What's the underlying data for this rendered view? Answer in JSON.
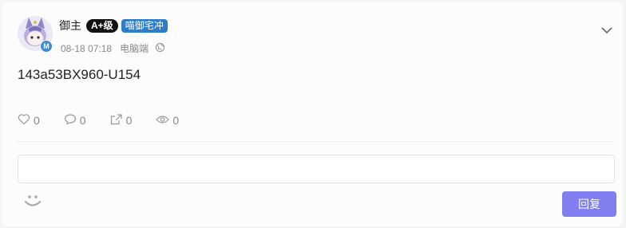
{
  "post": {
    "author": {
      "name": "御主",
      "level_badge": "A+级",
      "title_badge": "喵御宅冲",
      "verify_mark": "M"
    },
    "date": "08-18 07:18",
    "device": "电脑端",
    "content": "143a53BX960-U154"
  },
  "actions": {
    "likes": "0",
    "comments": "0",
    "shares": "0",
    "views": "0"
  },
  "reply": {
    "placeholder": "",
    "button_label": "回复"
  },
  "icons": {
    "like": "heart-icon",
    "comment": "comment-icon",
    "share": "share-icon",
    "view": "eye-icon",
    "visibility": "globe-icon",
    "menu": "chevron-down-icon",
    "emoji": "smiley-icon"
  },
  "colors": {
    "accent": "#7f7ff0",
    "title_badge": "#2f7dc6",
    "level_badge": "#111111",
    "verify": "#3d8bd6"
  }
}
